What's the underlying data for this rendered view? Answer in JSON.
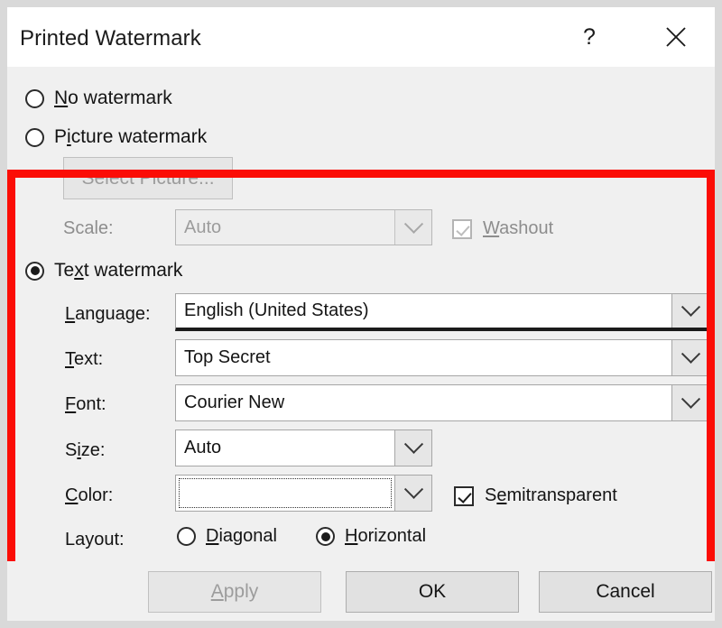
{
  "window": {
    "title": "Printed Watermark",
    "help_icon": "question-mark-icon",
    "close_icon": "close-x-icon",
    "help_glyph": "?",
    "close_glyph": "✕"
  },
  "options": {
    "no_watermark": {
      "label_pre": "",
      "accel": "N",
      "label_post": "o watermark",
      "selected": false,
      "enabled": true
    },
    "picture_watermark": {
      "label_pre": "P",
      "accel": "i",
      "label_post": "cture watermark",
      "selected": false,
      "enabled": true
    },
    "text_watermark": {
      "label_pre": "Te",
      "accel": "x",
      "label_post": "t watermark",
      "selected": true,
      "enabled": true
    }
  },
  "picture_section": {
    "select_picture_button": "Select Picture...",
    "select_picture_enabled": false,
    "scale": {
      "label": "Scale:",
      "value": "Auto",
      "enabled": false
    },
    "washout": {
      "label_pre": "",
      "accel": "W",
      "label_post": "ashout",
      "checked": true,
      "enabled": false
    }
  },
  "text_section": {
    "language": {
      "label_pre": "",
      "accel": "L",
      "label_post": "anguage:",
      "value": "English (United States)",
      "focused": true
    },
    "text": {
      "label_pre": "",
      "accel": "T",
      "label_post": "ext:",
      "value": "Top Secret"
    },
    "font": {
      "label_pre": "",
      "accel": "F",
      "label_post": "ont:",
      "value": "Courier New"
    },
    "size": {
      "label_pre": "S",
      "accel": "i",
      "label_post": "ze:",
      "value": "Auto"
    },
    "color": {
      "label_pre": "",
      "accel": "C",
      "label_post": "olor:",
      "value_hex": "#FB0D06",
      "focused": true
    },
    "semitransparent": {
      "label_pre": "S",
      "accel": "e",
      "label_post": "mitransparent",
      "checked": true,
      "enabled": true
    },
    "layout": {
      "label": "Layout:",
      "diagonal": {
        "label_pre": "",
        "accel": "D",
        "label_post": "iagonal",
        "selected": false
      },
      "horizontal": {
        "label_pre": "",
        "accel": "H",
        "label_post": "orizontal",
        "selected": true
      }
    }
  },
  "footer": {
    "apply": {
      "label_pre": "",
      "accel": "A",
      "label_post": "pply",
      "enabled": false
    },
    "ok": {
      "label": "OK"
    },
    "cancel": {
      "label": "Cancel"
    }
  },
  "annotation": {
    "highlight_color": "#FB0D06"
  }
}
